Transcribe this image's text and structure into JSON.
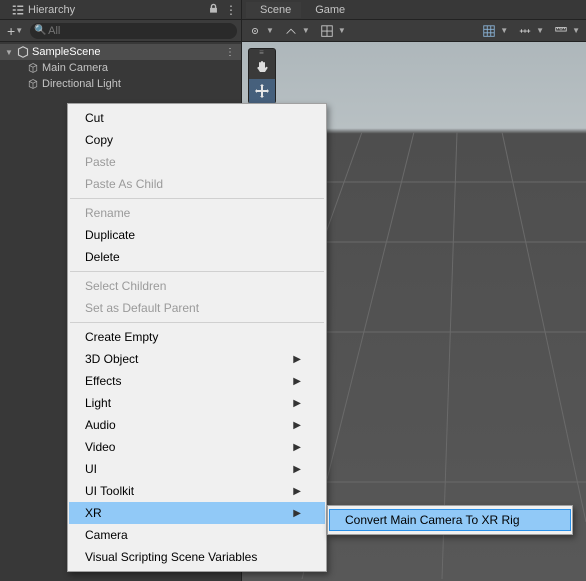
{
  "hierarchy": {
    "tab_label": "Hierarchy",
    "add_label": "+",
    "search_placeholder": "All",
    "scene_name": "SampleScene",
    "items": [
      {
        "label": "Main Camera"
      },
      {
        "label": "Directional Light"
      }
    ]
  },
  "scene": {
    "tabs": {
      "scene": "Scene",
      "game": "Game"
    }
  },
  "context_menu": {
    "cut": "Cut",
    "copy": "Copy",
    "paste": "Paste",
    "paste_as_child": "Paste As Child",
    "rename": "Rename",
    "duplicate": "Duplicate",
    "delete": "Delete",
    "select_children": "Select Children",
    "set_default_parent": "Set as Default Parent",
    "create_empty": "Create Empty",
    "object3d": "3D Object",
    "effects": "Effects",
    "light": "Light",
    "audio": "Audio",
    "video": "Video",
    "ui": "UI",
    "ui_toolkit": "UI Toolkit",
    "xr": "XR",
    "camera": "Camera",
    "vsv": "Visual Scripting Scene Variables"
  },
  "submenu": {
    "convert": "Convert Main Camera To XR Rig"
  }
}
